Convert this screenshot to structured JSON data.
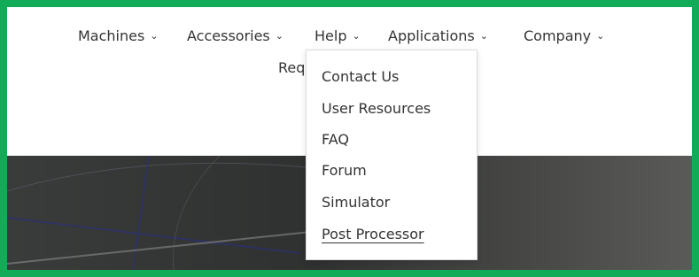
{
  "nav": {
    "items": [
      {
        "label": "Machines",
        "chevron": "chevron-down-icon"
      },
      {
        "label": "Accessories",
        "chevron": "chevron-down-icon"
      },
      {
        "label": "Help",
        "chevron": "chevron-down-icon"
      },
      {
        "label": "Applications",
        "chevron": "chevron-down-icon"
      },
      {
        "label": "Company",
        "chevron": "chevron-down-icon"
      }
    ],
    "row2_partial_label": "Req"
  },
  "help_menu": {
    "items": [
      {
        "label": "Contact Us"
      },
      {
        "label": "User Resources"
      },
      {
        "label": "FAQ"
      },
      {
        "label": "Forum"
      },
      {
        "label": "Simulator"
      },
      {
        "label": "Post Processor",
        "active": true
      }
    ]
  },
  "colors": {
    "frame_border": "#12ac59",
    "nav_text": "#333333",
    "hero_background": "#3a3c3b"
  }
}
